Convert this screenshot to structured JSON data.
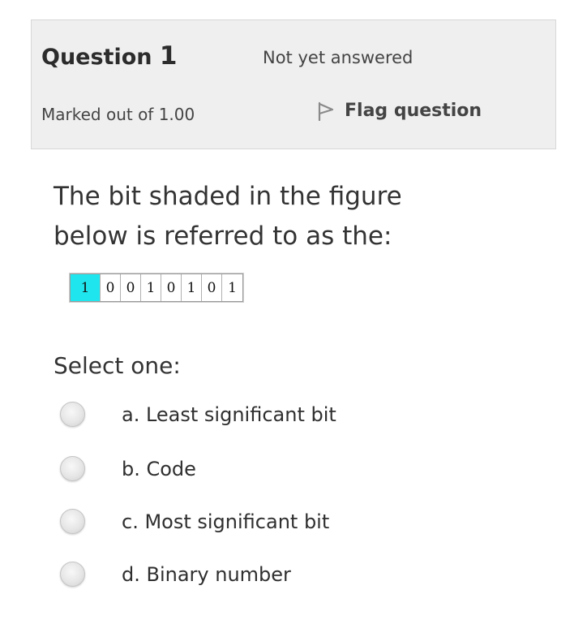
{
  "info": {
    "question_word": "Question",
    "question_number": "1",
    "state": "Not yet answered",
    "grade": "Marked out of 1.00",
    "flag_label": "Flag question"
  },
  "question": {
    "text_line1": "The bit shaded in the figure",
    "text_line2": "below is referred to as the:",
    "bits": [
      "1",
      "0",
      "0",
      "1",
      "0",
      "1",
      "0",
      "1"
    ],
    "shaded_bit_index": 0,
    "shaded_color": "#1fe6ee"
  },
  "answer": {
    "prompt": "Select one:",
    "options": [
      {
        "label": "a. Least significant bit",
        "selected": false
      },
      {
        "label": "b. Code",
        "selected": false
      },
      {
        "label": "c. Most significant bit",
        "selected": false
      },
      {
        "label": "d. Binary number",
        "selected": false
      }
    ]
  }
}
